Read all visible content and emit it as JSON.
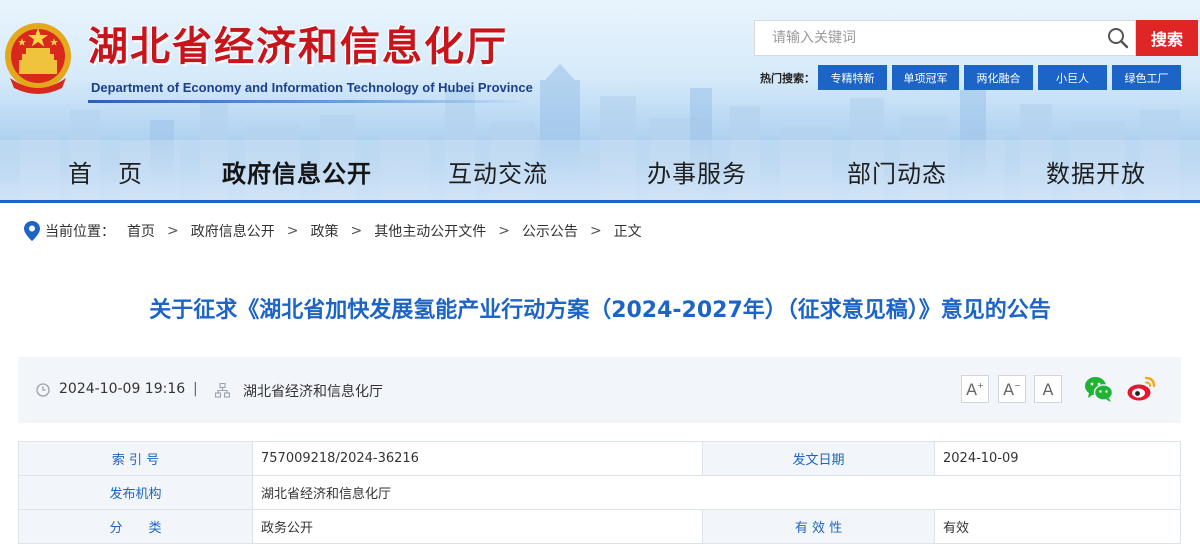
{
  "header": {
    "title": "湖北省经济和信息化厅",
    "subtitle": "Department of Economy and Information Technology of Hubei Province",
    "emblem_icon": "national-emblem-icon"
  },
  "search": {
    "placeholder": "请输入关键词",
    "button_label": "搜索",
    "hot_label": "热门搜索：",
    "hot_tags": [
      "专精特新",
      "单项冠军",
      "两化融合",
      "小巨人",
      "绿色工厂"
    ]
  },
  "nav": {
    "items": [
      "首　页",
      "政府信息公开",
      "互动交流",
      "办事服务",
      "部门动态",
      "数据开放"
    ],
    "active_index": 1
  },
  "breadcrumb": {
    "label": "当前位置：",
    "items": [
      "首页",
      "政府信息公开",
      "政策",
      "其他主动公开文件",
      "公示公告",
      "正文"
    ],
    "separator": ">"
  },
  "article": {
    "title": "关于征求《湖北省加快发展氢能产业行动方案（2024-2027年）（征求意见稿）》意见的公告",
    "date": "2024-10-09 19:16",
    "divider": "|",
    "publisher": "湖北省经济和信息化厅"
  },
  "font_controls": {
    "increase": "A",
    "reset": "A",
    "decrease": "A"
  },
  "meta": {
    "index_label": "索 引 号",
    "index_value": "757009218/2024-36216",
    "date_label": "发文日期",
    "date_value": "2024-10-09",
    "org_label": "发布机构",
    "org_value": "湖北省经济和信息化厅",
    "category_label": "分　　类",
    "category_value": "政务公开",
    "validity_label": "有 效 性",
    "validity_value": "有效"
  },
  "colors": {
    "brand_red": "#c8141b",
    "brand_blue": "#1d64c7",
    "search_red": "#e02525"
  }
}
